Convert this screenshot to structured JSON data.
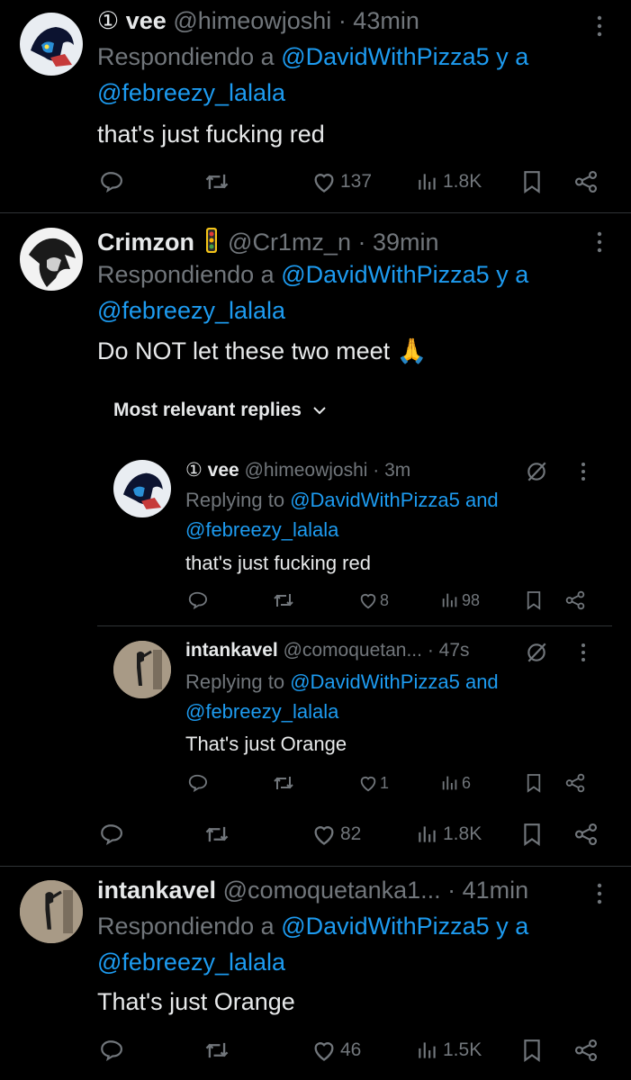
{
  "posts": [
    {
      "display_name": "vee",
      "badge_glyph": "①",
      "handle": "@himeowjoshi",
      "time": "· 43min",
      "reply_prefix": "Respondiendo a",
      "reply_user1": "@DavidWithPizza5",
      "reply_joiner": "y a",
      "reply_user2": "@febreezy_lalala",
      "text": "that's just fucking red",
      "likes": "137",
      "views": "1.8K"
    },
    {
      "display_name": "Crimzon",
      "handle": "@Cr1mz_n",
      "time": "· 39min",
      "reply_prefix": "Respondiendo a",
      "reply_user1": "@DavidWithPizza5",
      "reply_joiner": "y a",
      "reply_user2": "@febreezy_lalala",
      "text": "Do NOT let these two meet 🙏",
      "likes": "82",
      "views": "1.8K"
    },
    {
      "display_name": "intankavel",
      "handle": "@comoquetanka1...",
      "time": "· 41min",
      "reply_prefix": "Respondiendo a",
      "reply_user1": "@DavidWithPizza5",
      "reply_joiner": "y a",
      "reply_user2": "@febreezy_lalala",
      "text": "That's just Orange",
      "likes": "46",
      "views": "1.5K"
    }
  ],
  "replies_section": {
    "label": "Most relevant replies",
    "replies": [
      {
        "badge_glyph": "①",
        "display_name": "vee",
        "handle": "@himeowjoshi",
        "time": "· 3m",
        "reply_prefix": "Replying to",
        "reply_user1": "@DavidWithPizza5",
        "reply_joiner": "and",
        "reply_user2": "@febreezy_lalala",
        "text": "that's just fucking red",
        "likes": "8",
        "views": "98"
      },
      {
        "display_name": "intankavel",
        "handle": "@comoquetan...",
        "time": "· 47s",
        "reply_prefix": "Replying to",
        "reply_user1": "@DavidWithPizza5",
        "reply_joiner": "and",
        "reply_user2": "@febreezy_lalala",
        "text": "That's just Orange",
        "likes": "1",
        "views": "6"
      }
    ]
  },
  "colors": {
    "background": "#000000",
    "text": "#e7e9ea",
    "secondary": "#71767b",
    "link": "#1d9bf0",
    "divider": "#2f3336"
  }
}
